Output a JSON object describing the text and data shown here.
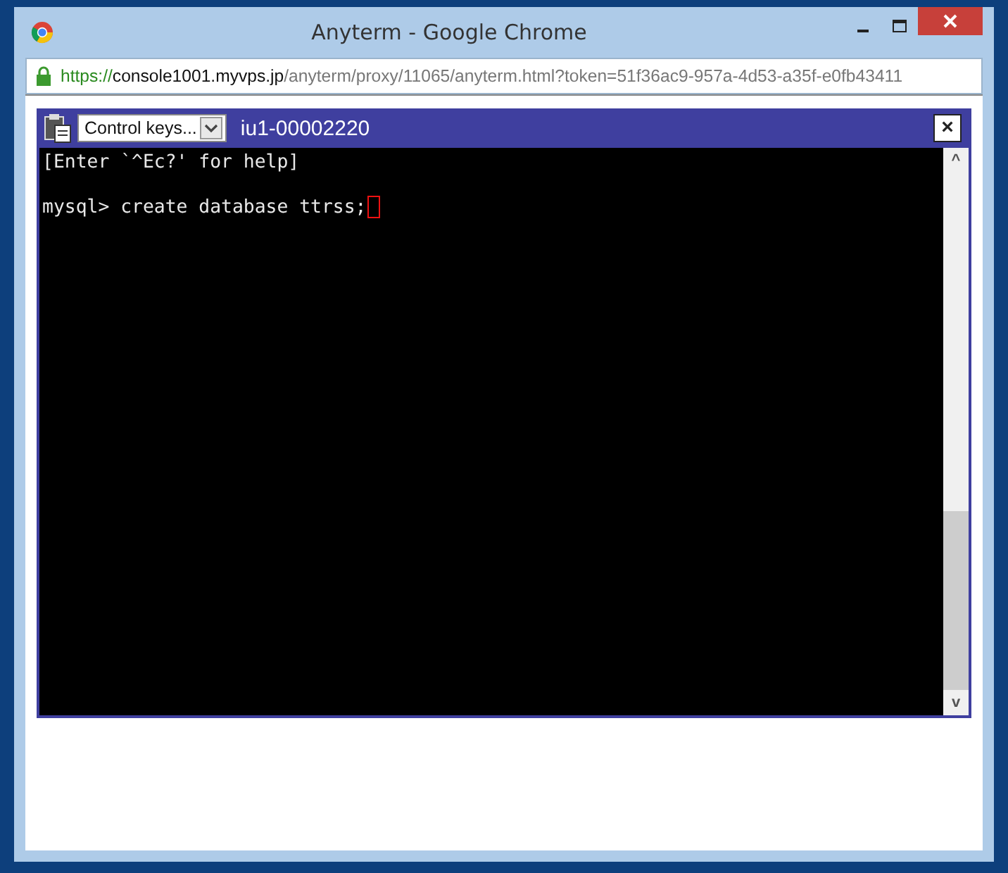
{
  "window": {
    "title": "Anyterm - Google Chrome"
  },
  "address_bar": {
    "scheme": "https://",
    "host": "console1001.myvps.jp",
    "path": "/anyterm/proxy/11065/anyterm.html?token=51f36ac9-957a-4d53-a35f-e0fb43411"
  },
  "terminal_header": {
    "control_keys": "Control keys...",
    "host_name": "iu1-00002220",
    "close": "×"
  },
  "terminal": {
    "lines": [
      {
        "text": "[Enter `^Ec?' for help]",
        "cursor": false
      },
      {
        "text": "mysql> create database ttrss;",
        "cursor": true
      }
    ],
    "scrollbar": {
      "up": "^",
      "down": "v"
    }
  }
}
